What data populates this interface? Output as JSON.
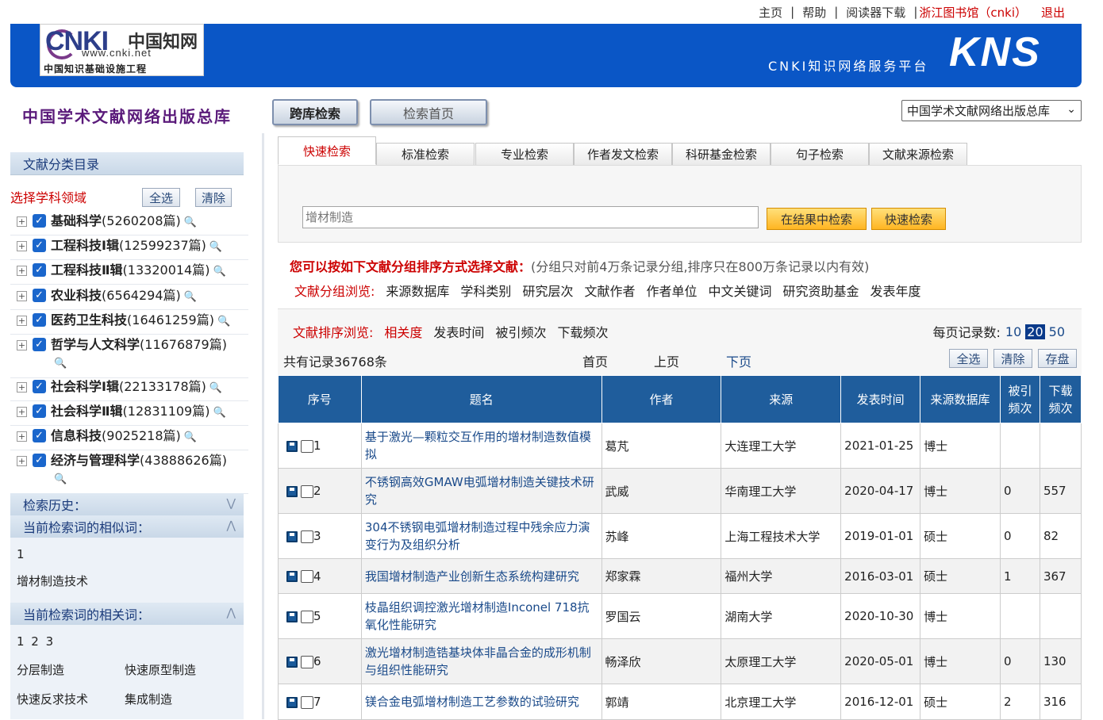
{
  "toplinks": {
    "home": "主页",
    "help": "帮助",
    "reader": "阅读器下载",
    "library": "浙江图书馆（cnki）",
    "logout": "退出"
  },
  "banner": {
    "logo_big": "CNKI",
    "logo_cn": "中国知网",
    "logo_url": "www.cnki.net",
    "logo_sub": "中国知识基础设施工程",
    "platform": "CNKI知识网络服务平台",
    "kns": "KNS"
  },
  "header": {
    "db_title": "中国学术文献网络出版总库",
    "cross_search": "跨库检索",
    "search_home": "检索首页",
    "db_select": "中国学术文献网络出版总库"
  },
  "sidebar": {
    "catalog_title": "文献分类目录",
    "pick_label": "选择学科领域",
    "select_all": "全选",
    "clear": "清除",
    "subjects": [
      {
        "name": "基础科学",
        "count": "(5260208篇)"
      },
      {
        "name": "工程科技Ⅰ辑",
        "count": "(12599237篇)"
      },
      {
        "name": "工程科技Ⅱ辑",
        "count": "(13320014篇)"
      },
      {
        "name": "农业科技",
        "count": "(6564294篇)"
      },
      {
        "name": "医药卫生科技",
        "count": "(16461259篇)"
      },
      {
        "name": "哲学与人文科学",
        "count": "(11676879篇)"
      },
      {
        "name": "社会科学Ⅰ辑",
        "count": "(22133178篇)"
      },
      {
        "name": "社会科学Ⅱ辑",
        "count": "(12831109篇)"
      },
      {
        "name": "信息科技",
        "count": "(9025218篇)"
      },
      {
        "name": "经济与管理科学",
        "count": "(43888626篇)"
      }
    ],
    "history_title": "检索历史：",
    "similar_title": "当前检索词的相似词：",
    "similar_page": "1",
    "similar_words": [
      "增材制造技术"
    ],
    "related_title": "当前检索词的相关词：",
    "related_pages": "1 2 3",
    "related_words": [
      "分层制造",
      "快速原型制造",
      "快速反求技术",
      "集成制造"
    ]
  },
  "tabs": [
    "快速检索",
    "标准检索",
    "专业检索",
    "作者发文检索",
    "科研基金检索",
    "句子检索",
    "文献来源检索"
  ],
  "search": {
    "value": "增材制造",
    "in_results": "在结果中检索",
    "quick": "快速检索"
  },
  "grouping": {
    "hint_red": "您可以按如下文献分组排序方式选择文献：",
    "hint_gray": "(分组只对前4万条记录分组,排序只在800万条记录以内有效)",
    "group_label": "文献分组浏览:",
    "groups": [
      "来源数据库",
      "学科类别",
      "研究层次",
      "文献作者",
      "作者单位",
      "中文关键词",
      "研究资助基金",
      "发表年度"
    ]
  },
  "sorting": {
    "label": "文献排序浏览:",
    "options": [
      "相关度",
      "发表时间",
      "被引频次",
      "下载频次"
    ],
    "per_page_label": "每页记录数:",
    "per_page": [
      "10",
      "20",
      "50"
    ],
    "total": "共有记录36768条",
    "first": "首页",
    "prev": "上页",
    "next": "下页",
    "select_all": "全选",
    "clear": "清除",
    "save": "存盘"
  },
  "table": {
    "headers": [
      "序号",
      "题名",
      "作者",
      "来源",
      "发表时间",
      "来源数据库",
      "被引频次",
      "下载频次"
    ],
    "rows": [
      {
        "no": "1",
        "title": "基于激光—颗粒交互作用的增材制造数值模拟",
        "author": "葛芃",
        "source": "大连理工大学",
        "date": "2021-01-25",
        "db": "博士",
        "cited": "",
        "downloads": ""
      },
      {
        "no": "2",
        "title": "不锈钢高效GMAW电弧增材制造关键技术研究",
        "author": "武威",
        "source": "华南理工大学",
        "date": "2020-04-17",
        "db": "博士",
        "cited": "0",
        "downloads": "557"
      },
      {
        "no": "3",
        "title": "304不锈钢电弧增材制造过程中残余应力演变行为及组织分析",
        "author": "苏峰",
        "source": "上海工程技术大学",
        "date": "2019-01-01",
        "db": "硕士",
        "cited": "0",
        "downloads": "82"
      },
      {
        "no": "4",
        "title": "我国增材制造产业创新生态系统构建研究",
        "author": "郑家霖",
        "source": "福州大学",
        "date": "2016-03-01",
        "db": "硕士",
        "cited": "1",
        "downloads": "367"
      },
      {
        "no": "5",
        "title": "枝晶组织调控激光增材制造Inconel 718抗氧化性能研究",
        "author": "罗国云",
        "source": "湖南大学",
        "date": "2020-10-30",
        "db": "博士",
        "cited": "",
        "downloads": ""
      },
      {
        "no": "6",
        "title": "激光增材制造锆基块体非晶合金的成形机制与组织性能研究",
        "author": "畅泽欣",
        "source": "太原理工大学",
        "date": "2020-05-01",
        "db": "博士",
        "cited": "0",
        "downloads": "130"
      },
      {
        "no": "7",
        "title": "镁合金电弧增材制造工艺参数的试验研究",
        "author": "郭靖",
        "source": "北京理工大学",
        "date": "2016-12-01",
        "db": "硕士",
        "cited": "2",
        "downloads": "316"
      }
    ]
  }
}
